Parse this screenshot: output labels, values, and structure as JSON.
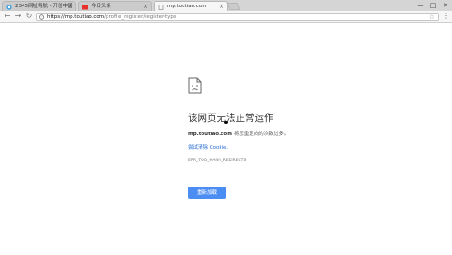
{
  "tabs": [
    {
      "title": "2345网址导航 - 开创中国",
      "active": false
    },
    {
      "title": "今日头条",
      "active": false
    },
    {
      "title": "mp.toutiao.com",
      "active": true
    }
  ],
  "window_controls": {
    "minimize": "—",
    "maximize": "□",
    "close": "✕"
  },
  "toolbar": {
    "url_host": "https://mp.toutiao.com",
    "url_path": "/profile_register/register-type"
  },
  "error_page": {
    "title": "该网页无法正常运作",
    "host": "mp.toutiao.com",
    "desc_suffix": " 将您重定向的次数过多。",
    "link": "尝试清除 Cookie.",
    "code": "ERR_TOO_MANY_REDIRECTS",
    "reload_label": "重新加载"
  },
  "colors": {
    "accent": "#4c8df3",
    "link": "#2a6fd4"
  }
}
